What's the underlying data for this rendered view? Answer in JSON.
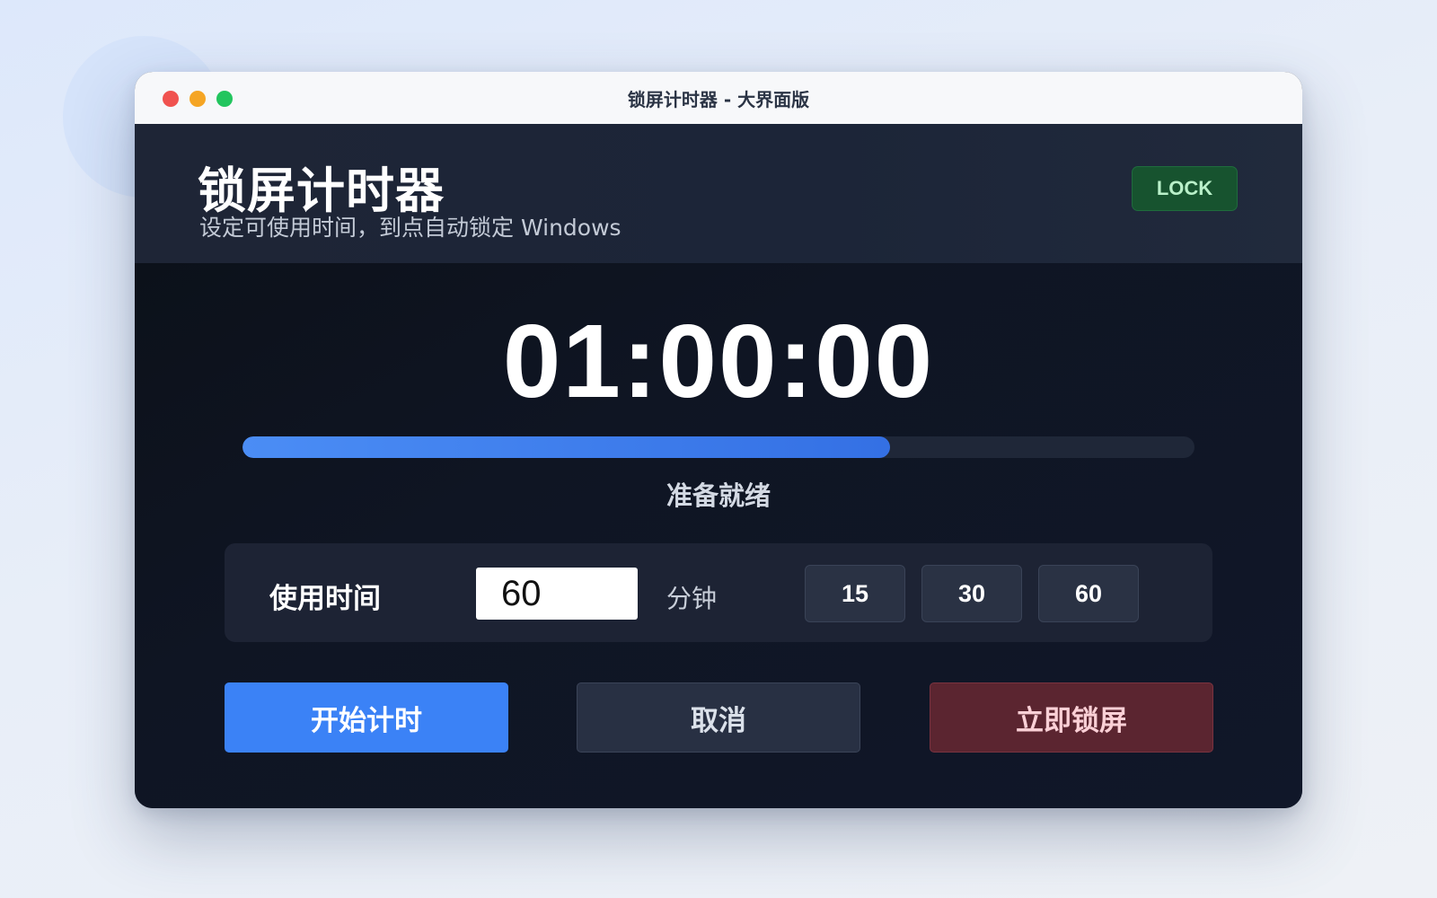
{
  "window": {
    "title": "锁屏计时器 - 大界面版"
  },
  "header": {
    "title": "锁屏计时器",
    "subtitle": "设定可使用时间，到点自动锁定 Windows",
    "badge": "LOCK"
  },
  "timer": {
    "display": "01:00:00",
    "progress_percent": 68,
    "status": "准备就绪"
  },
  "settings": {
    "label": "使用时间",
    "minutes_value": "60",
    "unit": "分钟",
    "presets": [
      "15",
      "30",
      "60"
    ]
  },
  "actions": {
    "start": "开始计时",
    "cancel": "取消",
    "lock_now": "立即锁屏"
  },
  "colors": {
    "accent": "#3b82f6",
    "lock_badge": "#17532f",
    "danger": "#5b2530"
  }
}
